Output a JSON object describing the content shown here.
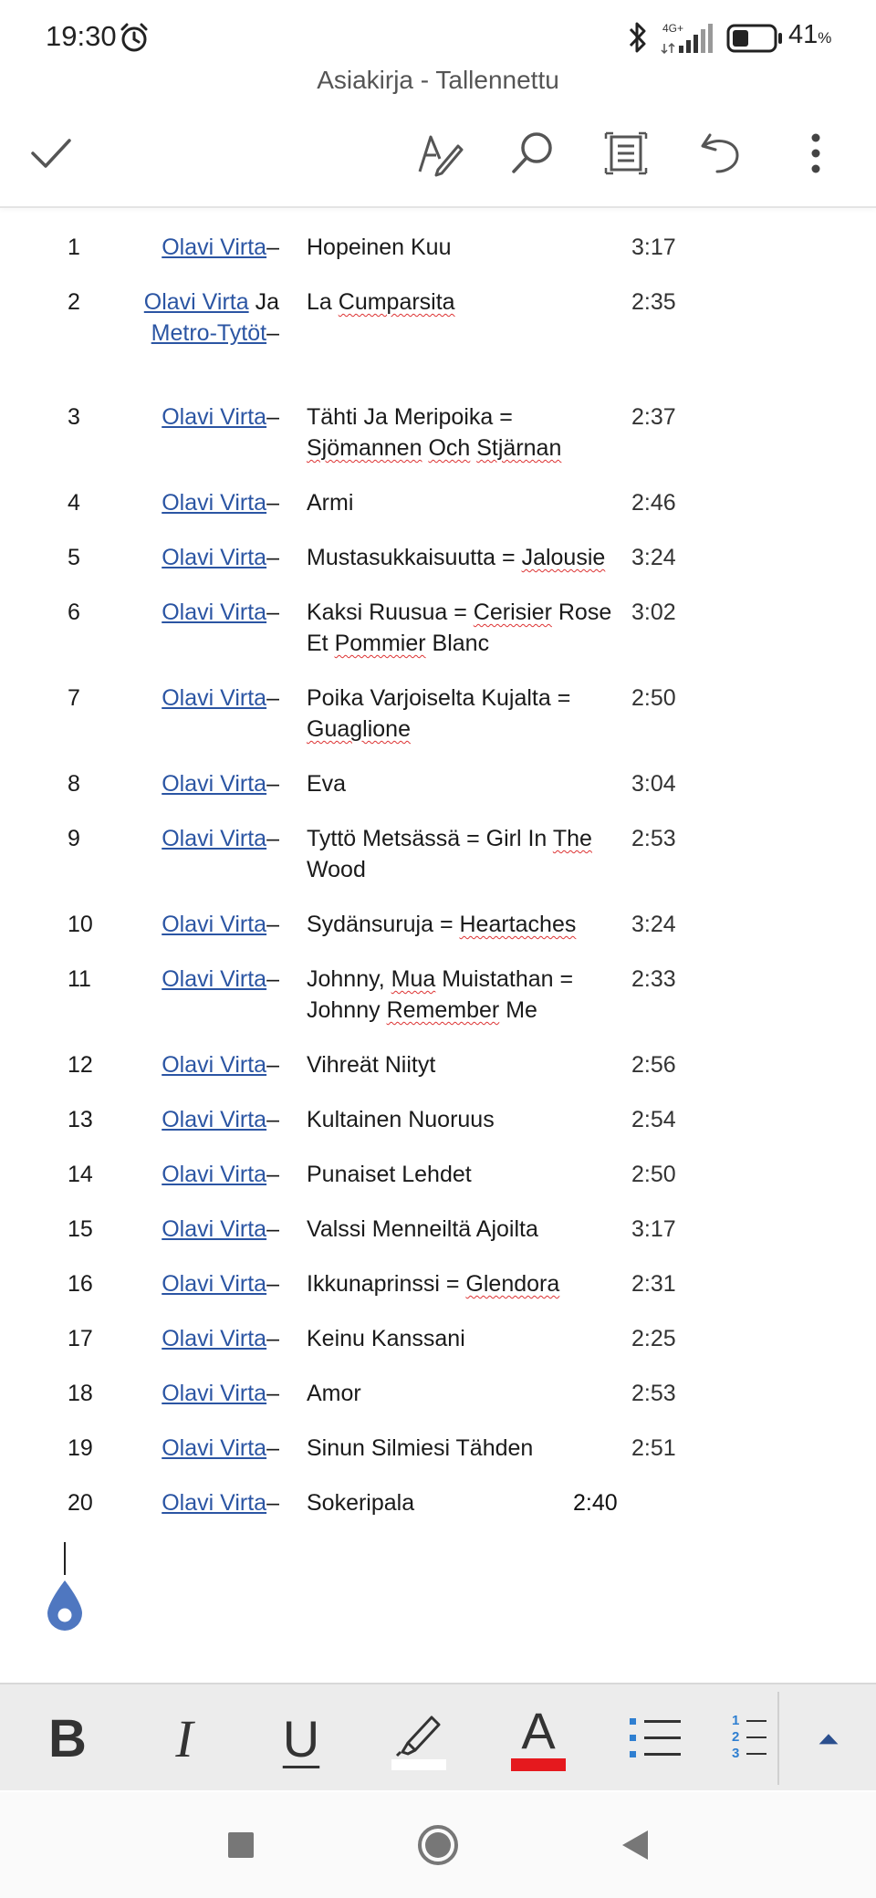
{
  "status": {
    "time": "19:30",
    "network": "4G+",
    "battery_percent": "41",
    "battery_unit": "%",
    "battery_level": 0.41,
    "icons": [
      "alarm-icon",
      "bluetooth-icon",
      "signal-icon",
      "battery-icon"
    ]
  },
  "document": {
    "title": "Asiakirja - Tallennettu"
  },
  "toolbar": {
    "icons": [
      "check-icon",
      "pen-icon",
      "search-icon",
      "read-mode-icon",
      "undo-icon",
      "more-icon"
    ]
  },
  "tracks": [
    {
      "num": "1",
      "artist": "Olavi Virta",
      "dash": "–",
      "title": "Hopeinen Kuu",
      "duration": "3:17"
    },
    {
      "num": "2",
      "artist": "Olavi Virta",
      "joiner": " Ja ",
      "artist2": "Metro-Tytöt",
      "dash": "–",
      "title": "La Cumparsita",
      "duration": "2:35"
    },
    {
      "num": "3",
      "artist": "Olavi Virta",
      "dash": "–",
      "title": "Tähti Ja Meripoika = Sjömannen Och Stjärnan",
      "duration": "2:37"
    },
    {
      "num": "4",
      "artist": "Olavi Virta",
      "dash": "–",
      "title": "Armi",
      "duration": "2:46"
    },
    {
      "num": "5",
      "artist": "Olavi Virta",
      "dash": "–",
      "title": "Mustasukkaisuutta = Jalousie",
      "duration": "3:24"
    },
    {
      "num": "6",
      "artist": "Olavi Virta",
      "dash": "–",
      "title": "Kaksi Ruusua = Cerisier Rose Et Pommier Blanc",
      "duration": "3:02"
    },
    {
      "num": "7",
      "artist": "Olavi Virta",
      "dash": "–",
      "title": "Poika Varjoiselta Kujalta = Guaglione",
      "duration": "2:50"
    },
    {
      "num": "8",
      "artist": "Olavi Virta",
      "dash": "–",
      "title": "Eva",
      "duration": "3:04"
    },
    {
      "num": "9",
      "artist": "Olavi Virta",
      "dash": "–",
      "title": "Tyttö Metsässä = Girl In The Wood",
      "duration": "2:53"
    },
    {
      "num": "10",
      "artist": "Olavi Virta",
      "dash": "–",
      "title": "Sydänsuruja = Heartaches",
      "duration": "3:24"
    },
    {
      "num": "11",
      "artist": "Olavi Virta",
      "dash": "–",
      "title": "Johnny, Mua Muistathan = Johnny Remember Me",
      "duration": "2:33"
    },
    {
      "num": "12",
      "artist": "Olavi Virta",
      "dash": "–",
      "title": "Vihreät Niityt",
      "duration": "2:56"
    },
    {
      "num": "13",
      "artist": "Olavi Virta",
      "dash": "–",
      "title": "Kultainen Nuoruus",
      "duration": "2:54"
    },
    {
      "num": "14",
      "artist": "Olavi Virta",
      "dash": "–",
      "title": "Punaiset Lehdet",
      "duration": "2:50"
    },
    {
      "num": "15",
      "artist": "Olavi Virta",
      "dash": "–",
      "title": "Valssi Menneiltä Ajoilta",
      "duration": "3:17"
    },
    {
      "num": "16",
      "artist": "Olavi Virta",
      "dash": "–",
      "title": "Ikkunaprinssi = Glendora",
      "duration": "2:31"
    },
    {
      "num": "17",
      "artist": "Olavi Virta",
      "dash": "–",
      "title": "Keinu Kanssani",
      "duration": "2:25"
    },
    {
      "num": "18",
      "artist": "Olavi Virta",
      "dash": "–",
      "title": "Amor",
      "duration": "2:53"
    },
    {
      "num": "19",
      "artist": "Olavi Virta",
      "dash": "–",
      "title": "Sinun Silmiesi Tähden",
      "duration": "2:51"
    },
    {
      "num": "20",
      "artist": "Olavi Virta",
      "dash": "–",
      "title": "Sokeripala",
      "duration": "2:40"
    }
  ],
  "format_bar": {
    "bold": "B",
    "italic": "I",
    "underline": "U",
    "font_color_letter": "A",
    "highlight_color": "#ffffff",
    "font_color": "#e5191e",
    "list_numbers": [
      "1",
      "2",
      "3"
    ],
    "icons": [
      "bold-icon",
      "italic-icon",
      "underline-icon",
      "highlighter-icon",
      "font-color-icon",
      "bullet-list-icon",
      "numbered-list-icon",
      "expand-icon"
    ]
  },
  "nav": {
    "icons": [
      "recent-apps-icon",
      "home-icon",
      "back-icon"
    ]
  },
  "colors": {
    "link": "#2b55a3",
    "accent": "#4472c4",
    "spell_error": "#d33"
  }
}
